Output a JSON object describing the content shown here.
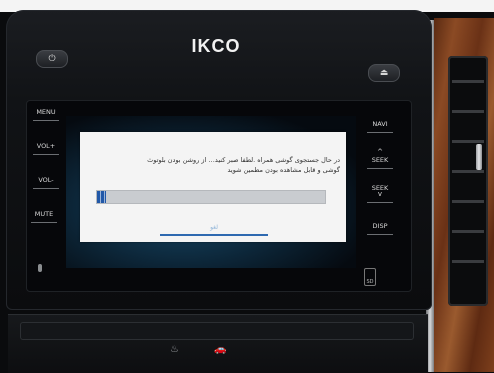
{
  "head_unit": {
    "brand": "IKCO",
    "power_icon": "power-icon",
    "eject_icon": "eject-icon"
  },
  "left_keys": [
    {
      "label": "MENU"
    },
    {
      "label": "VOL+"
    },
    {
      "label": "VOL-"
    },
    {
      "label": "MUTE"
    }
  ],
  "right_keys": [
    {
      "label": "NAVI",
      "sub": ""
    },
    {
      "label": "SEEK",
      "sub": "^"
    },
    {
      "label": "SEEK",
      "sub": "v"
    },
    {
      "label": "DISP",
      "sub": ""
    }
  ],
  "sd_slot": {
    "label": "SD"
  },
  "dialog": {
    "line1": "در حال جستجوی گوشی همراه .لطفا صبر کنید… از روشن بودن بلوتوث",
    "line2": "گوشی و قابل مشاهده بودن مطمین شوید",
    "progress_fraction": 0.04,
    "progress_color": "#2158a8",
    "cancel_label": "لغو"
  }
}
